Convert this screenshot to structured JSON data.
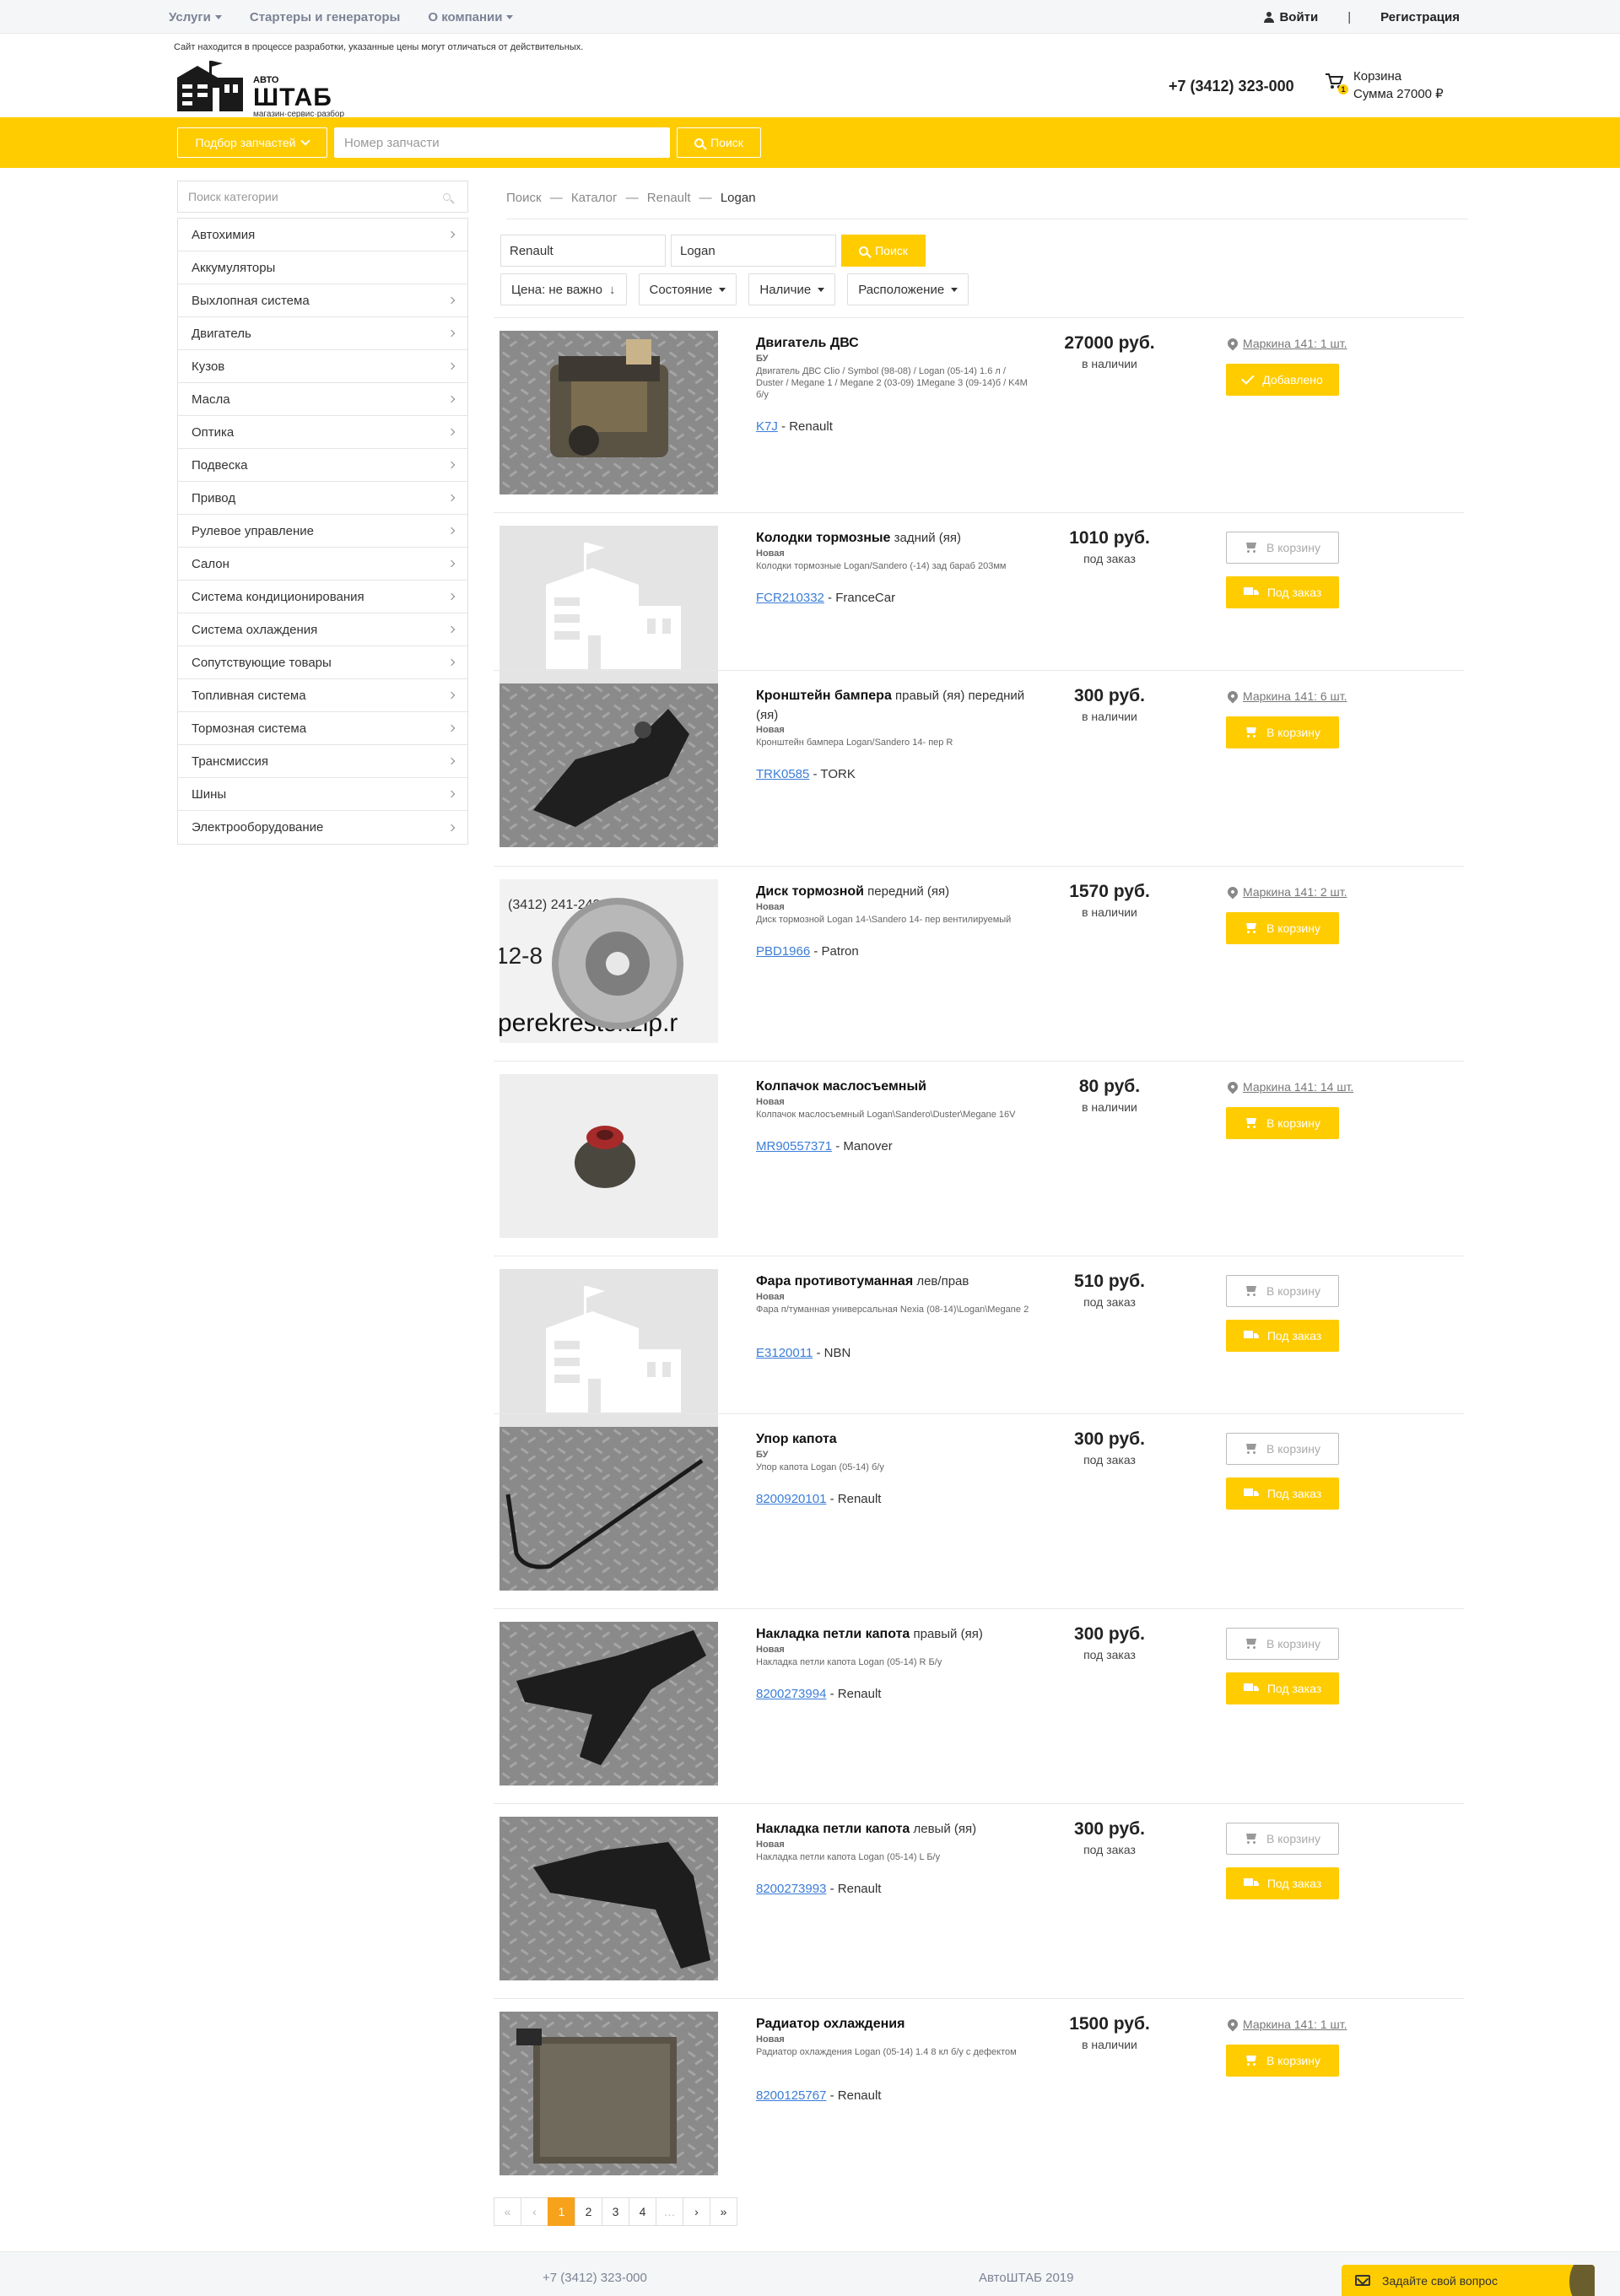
{
  "topnav": {
    "items": [
      "Услуги",
      "Стартеры и генераторы",
      "О компании"
    ],
    "login": "Войти",
    "separator": "|",
    "register": "Регистрация"
  },
  "header": {
    "notice": "Сайт находится в процессе разработки, указанные цены могут отличаться от действительных.",
    "logo_top": "АВТО",
    "logo_main": "ШТАБ",
    "logo_sub": "магазин·сервис·разбор",
    "phone": "+7 (3412) 323-000",
    "cart_label": "Корзина",
    "cart_sum": "Сумма 27000 ₽",
    "cart_count": "1"
  },
  "search_band": {
    "pick_label": "Подбор запчастей",
    "part_placeholder": "Номер запчасти",
    "search_label": "Поиск"
  },
  "sidebar": {
    "search_placeholder": "Поиск категории",
    "categories": [
      {
        "label": "Автохимия",
        "arrow": true
      },
      {
        "label": "Аккумуляторы",
        "arrow": false
      },
      {
        "label": "Выхлопная система",
        "arrow": true
      },
      {
        "label": "Двигатель",
        "arrow": true
      },
      {
        "label": "Кузов",
        "arrow": true
      },
      {
        "label": "Масла",
        "arrow": true
      },
      {
        "label": "Оптика",
        "arrow": true
      },
      {
        "label": "Подвеска",
        "arrow": true
      },
      {
        "label": "Привод",
        "arrow": true
      },
      {
        "label": "Рулевое управление",
        "arrow": true
      },
      {
        "label": "Салон",
        "arrow": true
      },
      {
        "label": "Система кондиционирования",
        "arrow": true
      },
      {
        "label": "Система охлаждения",
        "arrow": true
      },
      {
        "label": "Сопутствующие товары",
        "arrow": true
      },
      {
        "label": "Топливная система",
        "arrow": true
      },
      {
        "label": "Тормозная система",
        "arrow": true
      },
      {
        "label": "Трансмиссия",
        "arrow": true
      },
      {
        "label": "Шины",
        "arrow": true
      },
      {
        "label": "Электрооборудование",
        "arrow": true
      }
    ]
  },
  "breadcrumb": [
    "Поиск",
    "Каталог",
    "Renault",
    "Logan"
  ],
  "breadcrumb_sep": "—",
  "filters": {
    "brand": "Renault",
    "model": "Logan",
    "search_label": "Поиск",
    "sort_price": "Цена: не важно",
    "condition": "Состояние",
    "availability": "Наличие",
    "location": "Расположение"
  },
  "products": [
    {
      "name": "Двигатель ДВС",
      "pos": "",
      "cond": "БУ",
      "desc": "Двигатель ДВС Clio / Symbol (98-08) / Logan (05-14) 1.6 л / Duster / Megane 1 / Megane 2 (03-09) 1Megane 3 (09-14)б / K4M б/у",
      "code": "K7J",
      "brand": " - Renault",
      "price": "27000 руб.",
      "avail": "в наличии",
      "loc": "Маркина 141: 1 шт.",
      "btn1": "Добавлено",
      "btn2": "",
      "img": "engine"
    },
    {
      "name": "Колодки тормозные",
      "pos": " задний (яя)",
      "cond": "Новая",
      "desc": "Колодки тормозные Logan/Sandero (-14) зад бараб 203мм",
      "code": "FCR210332",
      "brand": " - FranceCar",
      "price": "1010 руб.",
      "avail": "под заказ",
      "loc": "",
      "btn1": "В корзину",
      "btn2": "Под заказ",
      "img": "placeholder"
    },
    {
      "name": "Кронштейн бампера",
      "pos": " правый (яя) передний (яя)",
      "cond": "Новая",
      "desc": "Кронштейн бампера Logan/Sandero 14- пер R",
      "code": "TRK0585",
      "brand": " - TORK",
      "price": "300 руб.",
      "avail": "в наличии",
      "loc": "Маркина 141: 6 шт.",
      "btn1": "В корзину",
      "btn2": "",
      "img": "bracket"
    },
    {
      "name": "Диск тормозной",
      "pos": " передний (яя)",
      "cond": "Новая",
      "desc": "Диск тормозной Logan 14-\\Sandero 14- пер вентилируемый",
      "code": "PBD1966",
      "brand": " - Patron",
      "price": "1570 руб.",
      "avail": "в наличии",
      "loc": "Маркина 141: 2 шт.",
      "btn1": "В корзину",
      "btn2": "",
      "img": "disc"
    },
    {
      "name": "Колпачок маслосъемный",
      "pos": "",
      "cond": "Новая",
      "desc": "Колпачок маслосъемный Logan\\Sandero\\Duster\\Megane 16V",
      "code": "MR90557371",
      "brand": " - Manover",
      "price": "80 руб.",
      "avail": "в наличии",
      "loc": "Маркина 141: 14 шт.",
      "btn1": "В корзину",
      "btn2": "",
      "img": "cap"
    },
    {
      "name": "Фара противотуманная",
      "pos": " лев/прав",
      "cond": "Новая",
      "desc": "Фара п/туманная универсальная Nexia (08-14)\\Logan\\Megane 2",
      "code": "E3120011",
      "brand": " - NBN",
      "price": "510 руб.",
      "avail": "под заказ",
      "loc": "",
      "btn1": "В корзину",
      "btn2": "Под заказ",
      "img": "placeholder"
    },
    {
      "name": "Упор капота",
      "pos": "",
      "cond": "БУ",
      "desc": "Упор капота Logan (05-14) б/у",
      "code": "8200920101",
      "brand": " - Renault",
      "price": "300 руб.",
      "avail": "под заказ",
      "loc": "",
      "btn1": "В корзину",
      "btn2": "Под заказ",
      "img": "rod"
    },
    {
      "name": "Накладка петли капота",
      "pos": " правый (яя)",
      "cond": "Новая",
      "desc": "Накладка петли капота Logan (05-14) R Б/у",
      "code": "8200273994",
      "brand": " - Renault",
      "price": "300 руб.",
      "avail": "под заказ",
      "loc": "",
      "btn1": "В корзину",
      "btn2": "Под заказ",
      "img": "cover"
    },
    {
      "name": "Накладка петли капота",
      "pos": " левый (яя)",
      "cond": "Новая",
      "desc": "Накладка петли капота Logan (05-14) L Б/у",
      "code": "8200273993",
      "brand": " - Renault",
      "price": "300 руб.",
      "avail": "под заказ",
      "loc": "",
      "btn1": "В корзину",
      "btn2": "Под заказ",
      "img": "cover2"
    },
    {
      "name": "Радиатор охлаждения",
      "pos": "",
      "cond": "Новая",
      "desc": "Радиатор охлаждения Logan (05-14) 1.4 8 кл б/у с дефектом",
      "code": "8200125767",
      "brand": " - Renault",
      "price": "1500 руб.",
      "avail": "в наличии",
      "loc": "Маркина 141: 1 шт.",
      "btn1": "В корзину",
      "btn2": "",
      "img": "radiator"
    }
  ],
  "pager": {
    "first": "«",
    "prev": "‹",
    "pages": [
      "1",
      "2",
      "3",
      "4"
    ],
    "ellipsis": "…",
    "next": "›",
    "last": "»",
    "current": "1"
  },
  "footer": {
    "phone": "+7 (3412) 323-000",
    "copyright": "АвтоШТАБ 2019",
    "ask": "Задайте свой вопрос"
  },
  "colors": {
    "accent": "#ffcc00",
    "pager_active": "#f7a21b",
    "link": "#3b7dd8"
  }
}
